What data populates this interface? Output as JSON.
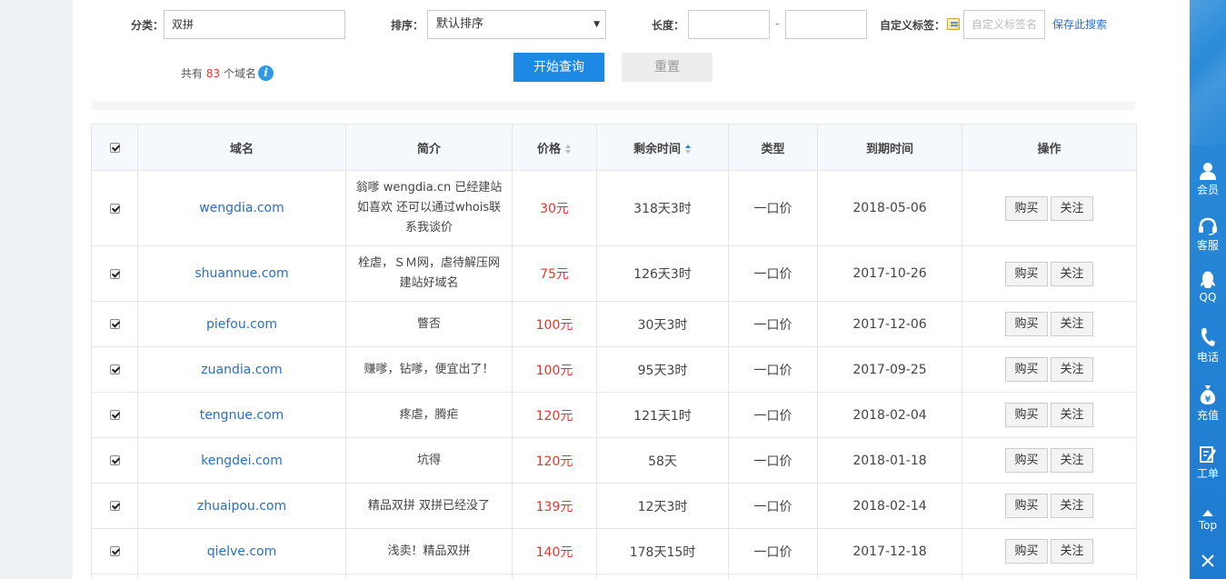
{
  "filters": {
    "category_label": "分类：",
    "category_value": "双拼",
    "sort_label": "排序：",
    "sort_value": "默认排序",
    "length_label": "长度：",
    "length_from": "",
    "length_to": "",
    "length_separator": "-",
    "custom_tag_label": "自定义标签：",
    "custom_tag_placeholder": "自定义标签名",
    "save_search": "保存此搜索",
    "query_button": "开始查询",
    "reset_button": "重置"
  },
  "summary": {
    "prefix": "共有",
    "count": "83",
    "suffix": "个域名"
  },
  "table": {
    "headers": {
      "domain": "域名",
      "desc": "简介",
      "price": "价格",
      "remaining": "剩余时间",
      "type": "类型",
      "expiry": "到期时间",
      "actions": "操作"
    },
    "buy_label": "购买",
    "follow_label": "关注",
    "rows": [
      {
        "domain": "wengdia.com",
        "desc": "翁嗲 wengdia.cn 已经建站 如喜欢 还可以通过whois联系我谈价",
        "price": "30元",
        "remaining": "318天3时",
        "type": "一口价",
        "expiry": "2018-05-06"
      },
      {
        "domain": "shuannue.com",
        "desc": "栓虐，ＳＭ网，虐待解压网建站好域名",
        "price": "75元",
        "remaining": "126天3时",
        "type": "一口价",
        "expiry": "2017-10-26"
      },
      {
        "domain": "piefou.com",
        "desc": "瞥否",
        "price": "100元",
        "remaining": "30天3时",
        "type": "一口价",
        "expiry": "2017-12-06"
      },
      {
        "domain": "zuandia.com",
        "desc": "赚嗲，钻嗲，便宜出了！",
        "price": "100元",
        "remaining": "95天3时",
        "type": "一口价",
        "expiry": "2017-09-25"
      },
      {
        "domain": "tengnue.com",
        "desc": "疼虐，腾疟",
        "price": "120元",
        "remaining": "121天1时",
        "type": "一口价",
        "expiry": "2018-02-04"
      },
      {
        "domain": "kengdei.com",
        "desc": "坑得",
        "price": "120元",
        "remaining": "58天",
        "type": "一口价",
        "expiry": "2018-01-18"
      },
      {
        "domain": "zhuaipou.com",
        "desc": "精品双拼 双拼已经没了",
        "price": "139元",
        "remaining": "12天3时",
        "type": "一口价",
        "expiry": "2018-02-14"
      },
      {
        "domain": "qielve.com",
        "desc": "浅卖！精品双拼",
        "price": "140元",
        "remaining": "178天15时",
        "type": "一口价",
        "expiry": "2017-12-18"
      },
      {
        "domain": "",
        "desc": "",
        "price": "",
        "remaining": "",
        "type": "",
        "expiry": ""
      }
    ]
  },
  "sidebar": {
    "member": "会员",
    "service": "客服",
    "qq": "QQ",
    "phone": "电话",
    "recharge": "充值",
    "ticket": "工单",
    "top": "Top"
  },
  "icons": [
    "info-icon",
    "tag-icon",
    "sort-icon",
    "user-icon",
    "headset-icon",
    "qq-icon",
    "phone-icon",
    "money-bag-icon",
    "edit-icon",
    "arrow-up-icon",
    "close-icon"
  ],
  "colors": {
    "accent": "#1e88e5",
    "price": "#e2372b",
    "link": "#2a6fc4",
    "sidebar": "#2385d6"
  }
}
